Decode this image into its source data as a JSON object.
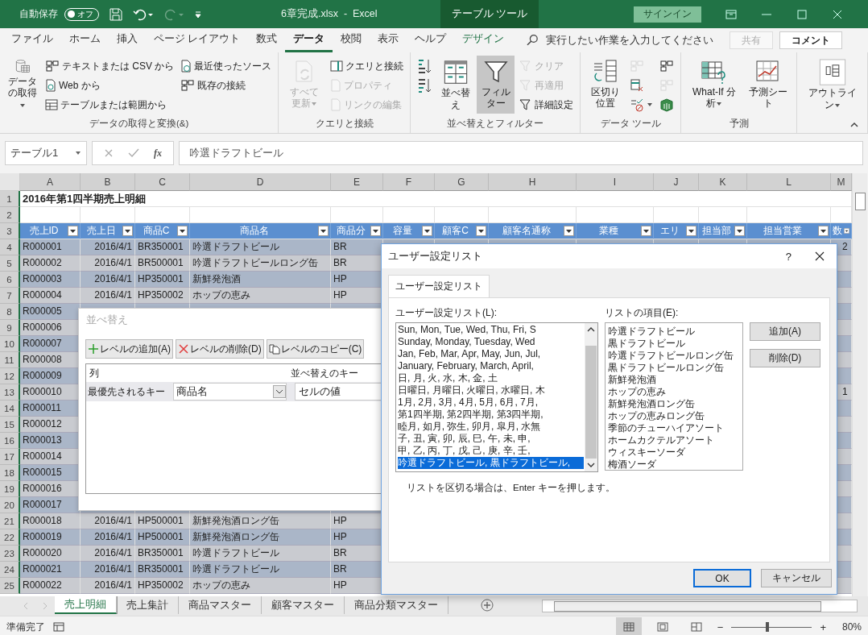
{
  "title_bar": {
    "autosave_label": "自動保存",
    "autosave": {
      "label": "オフ",
      "on": false
    },
    "redo_disabled": true,
    "title": "6章完成.xlsx  -  Excel",
    "context_tab": "テーブル ツール",
    "sign_in": "サインイン"
  },
  "menu_tabs": [
    {
      "label": "ファイル",
      "selected": false,
      "kind": "normal"
    },
    {
      "label": "ホーム",
      "selected": false,
      "kind": "normal"
    },
    {
      "label": "挿入",
      "selected": false,
      "kind": "normal"
    },
    {
      "label": "ページ レイアウト",
      "selected": false,
      "kind": "normal"
    },
    {
      "label": "数式",
      "selected": false,
      "kind": "normal"
    },
    {
      "label": "データ",
      "selected": true,
      "kind": "normal"
    },
    {
      "label": "校閲",
      "selected": false,
      "kind": "normal"
    },
    {
      "label": "表示",
      "selected": false,
      "kind": "normal"
    },
    {
      "label": "ヘルプ",
      "selected": false,
      "kind": "normal"
    },
    {
      "label": "デザイン",
      "selected": false,
      "kind": "context"
    }
  ],
  "tell_me": {
    "placeholder": "実行したい作業を入力してください"
  },
  "share": {
    "label": "共有",
    "disabled": true
  },
  "comment": {
    "label": "コメント"
  },
  "ribbon": {
    "groups": [
      {
        "label": "データの取得と変換(&)",
        "items": [
          {
            "label": "データの取得",
            "kind": "large",
            "disabled": false,
            "pressed": false,
            "dropdown": true
          },
          {
            "label": "テキストまたは CSV から",
            "kind": "small",
            "disabled": false,
            "pressed": false,
            "dropdown": false
          },
          {
            "label": "Web から",
            "kind": "small",
            "disabled": false,
            "pressed": false,
            "dropdown": false
          },
          {
            "label": "テーブルまたは範囲から",
            "kind": "small",
            "disabled": false,
            "pressed": false,
            "dropdown": false
          },
          {
            "label": "最近使ったソース",
            "kind": "small",
            "disabled": false,
            "pressed": false,
            "dropdown": false
          },
          {
            "label": "既存の接続",
            "kind": "small",
            "disabled": false,
            "pressed": false,
            "dropdown": false
          }
        ]
      },
      {
        "label": "クエリと接続",
        "items": [
          {
            "label": "すべて更新",
            "kind": "large",
            "disabled": true,
            "pressed": false,
            "dropdown": true
          },
          {
            "label": "クエリと接続",
            "kind": "small",
            "disabled": false,
            "pressed": false,
            "dropdown": false
          },
          {
            "label": "プロパティ",
            "kind": "small",
            "disabled": true,
            "pressed": false,
            "dropdown": false
          },
          {
            "label": "リンクの編集",
            "kind": "small",
            "disabled": true,
            "pressed": false,
            "dropdown": false
          }
        ]
      },
      {
        "label": "並べ替えとフィルター",
        "items": [
          {
            "kind": "icon",
            "disabled": false,
            "pressed": false,
            "dropdown": false
          },
          {
            "kind": "icon",
            "disabled": false,
            "pressed": false,
            "dropdown": false
          },
          {
            "label": "並べ替え",
            "kind": "large",
            "disabled": false,
            "pressed": false,
            "dropdown": false
          },
          {
            "label": "フィルター",
            "kind": "large",
            "disabled": false,
            "pressed": true,
            "dropdown": false
          },
          {
            "label": "クリア",
            "kind": "small",
            "disabled": true,
            "pressed": false,
            "dropdown": false
          },
          {
            "label": "再適用",
            "kind": "small",
            "disabled": true,
            "pressed": false,
            "dropdown": false
          },
          {
            "label": "詳細設定",
            "kind": "small",
            "disabled": false,
            "pressed": false,
            "dropdown": false
          }
        ]
      },
      {
        "label": "データ ツール",
        "items": [
          {
            "label": "区切り位置",
            "kind": "large",
            "disabled": false,
            "pressed": false,
            "dropdown": false
          },
          {
            "kind": "icon",
            "disabled": true,
            "pressed": false,
            "dropdown": false
          },
          {
            "kind": "icon",
            "disabled": false,
            "pressed": false,
            "dropdown": false
          },
          {
            "kind": "icon",
            "disabled": false,
            "pressed": false,
            "dropdown": true
          },
          {
            "kind": "icon",
            "disabled": false,
            "pressed": false,
            "dropdown": false
          },
          {
            "kind": "icon",
            "disabled": true,
            "pressed": false,
            "dropdown": false
          },
          {
            "kind": "icon",
            "disabled": false,
            "pressed": false,
            "dropdown": false
          }
        ]
      },
      {
        "label": "予測",
        "items": [
          {
            "label": "What-If 分析",
            "kind": "large",
            "disabled": false,
            "pressed": false,
            "dropdown": true
          },
          {
            "label": "予測シート",
            "kind": "large",
            "disabled": false,
            "pressed": false,
            "dropdown": false
          }
        ]
      },
      {
        "items": [
          {
            "label": "アウトライン",
            "kind": "large",
            "disabled": false,
            "pressed": false,
            "dropdown": true
          }
        ]
      }
    ]
  },
  "formula_bar": {
    "name_box": "テーブル1",
    "function_label": "fx",
    "formula": "吟選ドラフトビール"
  },
  "sheet": {
    "columns": [
      "A",
      "B",
      "C",
      "D",
      "E",
      "F",
      "G",
      "H",
      "I",
      "J",
      "K",
      "L",
      "M"
    ],
    "rows": [
      {
        "num": "1",
        "kind": "title",
        "cells": [
          "2016年第1四半期売上明細"
        ]
      },
      {
        "num": "2",
        "kind": "blank"
      },
      {
        "num": "3",
        "kind": "header",
        "cells": [
          "売上ID",
          "売上日",
          "商品C",
          "商品名",
          "商品分",
          "容量",
          "顧客C",
          "顧客名通称",
          "業種",
          "エリ",
          "担当部",
          "担当営業",
          "数"
        ]
      },
      {
        "num": "4",
        "kind": "data",
        "cells": [
          "R000001",
          "2016/4/1",
          "BR350001",
          "吟選ドラフトビール",
          "BR",
          null,
          null,
          null,
          null,
          null,
          null,
          null,
          "2"
        ]
      },
      {
        "num": "5",
        "kind": "data",
        "cells": [
          "R000002",
          "2016/4/1",
          "BR500001",
          "吟選ドラフトビールロング缶",
          "BR"
        ]
      },
      {
        "num": "6",
        "kind": "data",
        "cells": [
          "R000003",
          "2016/4/1",
          "HP350001",
          "新鮮発泡酒",
          "HP"
        ]
      },
      {
        "num": "7",
        "kind": "data",
        "cells": [
          "R000004",
          "2016/4/1",
          "HP350002",
          "ホップの恵み",
          "HP"
        ]
      },
      {
        "num": "8",
        "kind": "data",
        "cells": [
          "R000005"
        ]
      },
      {
        "num": "9",
        "kind": "data",
        "cells": [
          "R000006"
        ]
      },
      {
        "num": "10",
        "kind": "data",
        "cells": [
          "R000007"
        ]
      },
      {
        "num": "11",
        "kind": "data",
        "cells": [
          "R000008"
        ]
      },
      {
        "num": "12",
        "kind": "data",
        "cells": [
          "R000009"
        ]
      },
      {
        "num": "13",
        "kind": "data",
        "cells": [
          "R000010",
          null,
          null,
          null,
          null,
          null,
          null,
          null,
          null,
          null,
          null,
          null,
          "1"
        ]
      },
      {
        "num": "14",
        "kind": "data",
        "cells": [
          "R000011"
        ]
      },
      {
        "num": "15",
        "kind": "data",
        "cells": [
          "R000012"
        ]
      },
      {
        "num": "16",
        "kind": "data",
        "cells": [
          "R000013"
        ]
      },
      {
        "num": "17",
        "kind": "data",
        "cells": [
          "R000014"
        ]
      },
      {
        "num": "18",
        "kind": "data",
        "cells": [
          "R000015"
        ]
      },
      {
        "num": "19",
        "kind": "data",
        "cells": [
          "R000016"
        ]
      },
      {
        "num": "20",
        "kind": "data",
        "cells": [
          "R000017"
        ]
      },
      {
        "num": "21",
        "kind": "data",
        "cells": [
          "R000018",
          "2016/4/1",
          "HP500001",
          "新鮮発泡酒ロング缶",
          "HP"
        ]
      },
      {
        "num": "22",
        "kind": "data",
        "cells": [
          "R000019",
          "2016/4/1",
          "HP500001",
          "新鮮発泡酒ロング缶",
          "HP"
        ]
      },
      {
        "num": "23",
        "kind": "data",
        "cells": [
          "R000020",
          "2016/4/1",
          "BR350001",
          "吟選ドラフトビール",
          "BR"
        ]
      },
      {
        "num": "24",
        "kind": "data",
        "cells": [
          "R000021",
          "2016/4/1",
          "BR350001",
          "吟選ドラフトビール",
          "BR"
        ]
      },
      {
        "num": "25",
        "kind": "data",
        "cells": [
          "R000022",
          "2016/4/1",
          "HP350002",
          "ホップの恵み",
          "HP"
        ]
      }
    ]
  },
  "sort_dialog": {
    "title": "並べ替え",
    "buttons": [
      "レベルの追加(A)",
      "レベルの削除(D)",
      "レベルのコピー(C)"
    ],
    "column_header": "列",
    "key_header": "並べ替えのキー",
    "row_label": "最優先されるキー",
    "column_value": "商品名",
    "key_value": "セルの値"
  },
  "custom_list_dialog": {
    "title": "ユーザー設定リスト",
    "help": "?",
    "tab": "ユーザー設定リスト",
    "lists_label": "ユーザー設定リスト(L):",
    "lists": [
      {
        "text": "Sun, Mon, Tue, Wed, Thu, Fri, S",
        "selected": false
      },
      {
        "text": "Sunday, Monday, Tuesday, Wed",
        "selected": false
      },
      {
        "text": "Jan, Feb, Mar, Apr, May, Jun, Jul,",
        "selected": false
      },
      {
        "text": "January, February, March, April,",
        "selected": false
      },
      {
        "text": "日, 月, 火, 水, 木, 金, 土",
        "selected": false
      },
      {
        "text": "日曜日, 月曜日, 火曜日, 水曜日, 木",
        "selected": false
      },
      {
        "text": "1月, 2月, 3月, 4月, 5月, 6月, 7月,",
        "selected": false
      },
      {
        "text": "第1四半期, 第2四半期, 第3四半期,",
        "selected": false
      },
      {
        "text": "睦月, 如月, 弥生, 卯月, 皐月, 水無",
        "selected": false
      },
      {
        "text": "子, 丑, 寅, 卯, 辰, 巳, 午, 未, 申,",
        "selected": false
      },
      {
        "text": "甲, 乙, 丙, 丁, 戊, 己, 庚, 辛, 壬,",
        "selected": false
      },
      {
        "text": "吟選ドラフトビール, 黒ドラフトビール,",
        "selected": true
      }
    ],
    "entries_label": "リストの項目(E):",
    "entries": [
      "吟選ドラフトビール",
      "黒ドラフトビール",
      "吟選ドラフトビールロング缶",
      "黒ドラフトビールロング缶",
      "新鮮発泡酒",
      "ホップの恵み",
      "新鮮発泡酒ロング缶",
      "ホップの恵みロング缶",
      "季節のチューハイアソート",
      "ホームカクテルアソート",
      "ウィスキーソーダ",
      "梅酒ソーダ"
    ],
    "add": "追加(A)",
    "delete": "削除(D)",
    "hint": "リストを区切る場合は、Enter キーを押します。",
    "ok": "OK",
    "cancel": "キャンセル"
  },
  "sheet_tabs": [
    {
      "label": "売上明細",
      "selected": true
    },
    {
      "label": "売上集計",
      "selected": false
    },
    {
      "label": "商品マスター",
      "selected": false
    },
    {
      "label": "顧客マスター",
      "selected": false
    },
    {
      "label": "商品分類マスター",
      "selected": false
    }
  ],
  "status_bar": {
    "status": "準備完了",
    "views": [
      {
        "selected": true
      },
      {
        "selected": false
      },
      {
        "selected": false
      }
    ],
    "zoom": {
      "minus": "−",
      "plus": "+",
      "level": 0.45,
      "label": "80%"
    }
  }
}
